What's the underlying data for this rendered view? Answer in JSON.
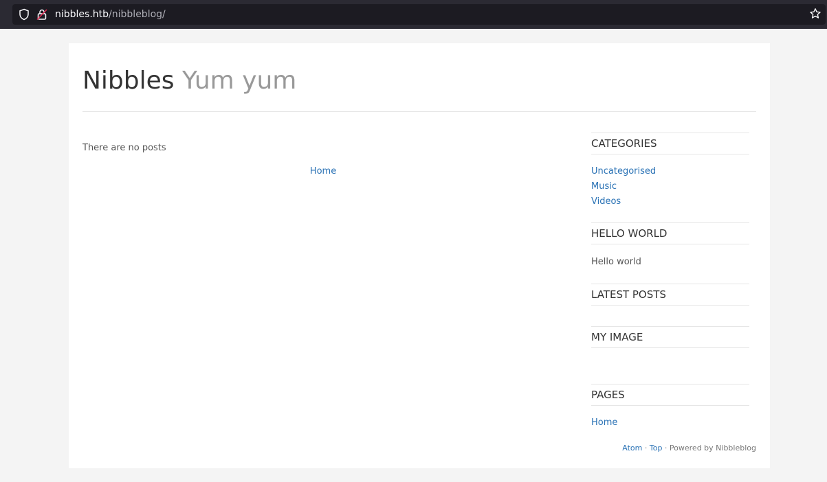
{
  "browser": {
    "url_host": "nibbles.htb",
    "url_path": "/nibbleblog/"
  },
  "header": {
    "title": "Nibbles",
    "slogan": "Yum yum"
  },
  "main": {
    "no_posts": "There are no posts",
    "pager_home": "Home"
  },
  "sidebar": {
    "categories": {
      "title": "CATEGORIES",
      "items": [
        "Uncategorised",
        "Music",
        "Videos"
      ]
    },
    "hello_world": {
      "title": "HELLO WORLD",
      "text": "Hello world"
    },
    "latest_posts": {
      "title": "LATEST POSTS"
    },
    "my_image": {
      "title": "MY IMAGE"
    },
    "pages": {
      "title": "PAGES",
      "items": [
        "Home"
      ]
    }
  },
  "footer": {
    "atom": "Atom",
    "sep1": " · ",
    "top": "Top",
    "powered": " · Powered by Nibbleblog"
  }
}
